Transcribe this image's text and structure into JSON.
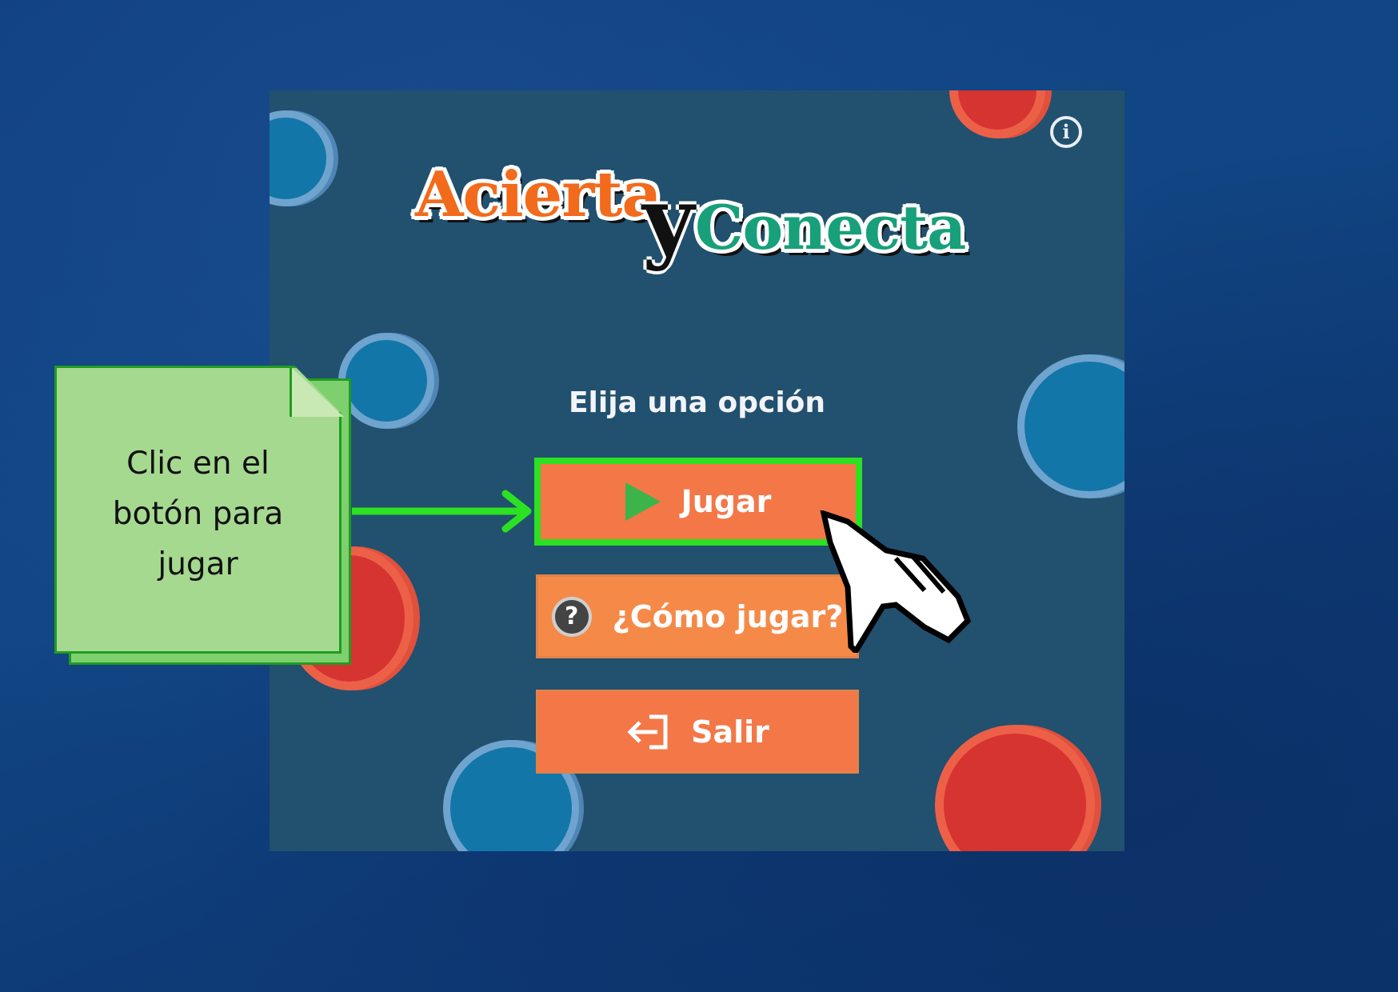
{
  "logo": {
    "part1": "Acierta",
    "part2": "y",
    "part3": "Conecta"
  },
  "info_button": {
    "symbol": "i"
  },
  "menu": {
    "prompt": "Elija una opción",
    "play_label": "Jugar",
    "howto_label": "¿Cómo jugar?",
    "exit_label": "Salir"
  },
  "annotation": {
    "line1": "Clic en el",
    "line2": "botón para",
    "line3": "jugar"
  },
  "icons": {
    "play": "play-icon",
    "help": "help-icon",
    "exit": "exit-icon",
    "info": "info-icon",
    "cursor": "hand-cursor-icon"
  },
  "colors": {
    "page_bg": "#114684",
    "window_bg": "#22506f",
    "button": "#f47748",
    "highlight": "#2ce022",
    "note": "#a6d990",
    "logo_orange": "#f26a1b",
    "logo_green": "#17a07a"
  }
}
